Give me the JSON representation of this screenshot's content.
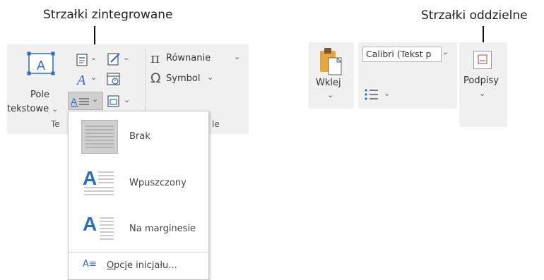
{
  "callouts": {
    "integrated": "Strzałki zintegrowane",
    "separate": "Strzałki oddzielne"
  },
  "ribbon_left": {
    "text_box_label_line1": "Pole",
    "text_box_label_line2": "tekstowe",
    "equation_label": "Równanie",
    "symbol_label": "Symbol",
    "group_text_partial_left": "Te",
    "group_symbols_partial": "le",
    "chevron": "⌄"
  },
  "dropcap_menu": {
    "items": [
      {
        "label": "Brak"
      },
      {
        "label": "Wpuszczony"
      },
      {
        "label": "Na marginesie"
      }
    ],
    "options_label_underlined": "O",
    "options_label_rest": "pcje inicjału...",
    "options_icon_text": "A≡"
  },
  "ribbon_right": {
    "paste_label": "Wklej",
    "font_name": "Calibri (Tekst p",
    "signatures_label": "Podpisy"
  },
  "colors": {
    "ribbon_bg": "#f0f0f0",
    "accent_blue": "#2b6cc4",
    "highlight": "#cfcfcf",
    "clipboard_orange": "#e9a53a"
  },
  "icons": [
    "text-box-icon",
    "quick-parts-icon",
    "wordart-icon",
    "dropcap-icon",
    "signature-line-icon",
    "date-time-icon",
    "object-icon",
    "equation-icon",
    "symbol-icon",
    "paste-icon",
    "bullets-icon",
    "signature-icon"
  ]
}
